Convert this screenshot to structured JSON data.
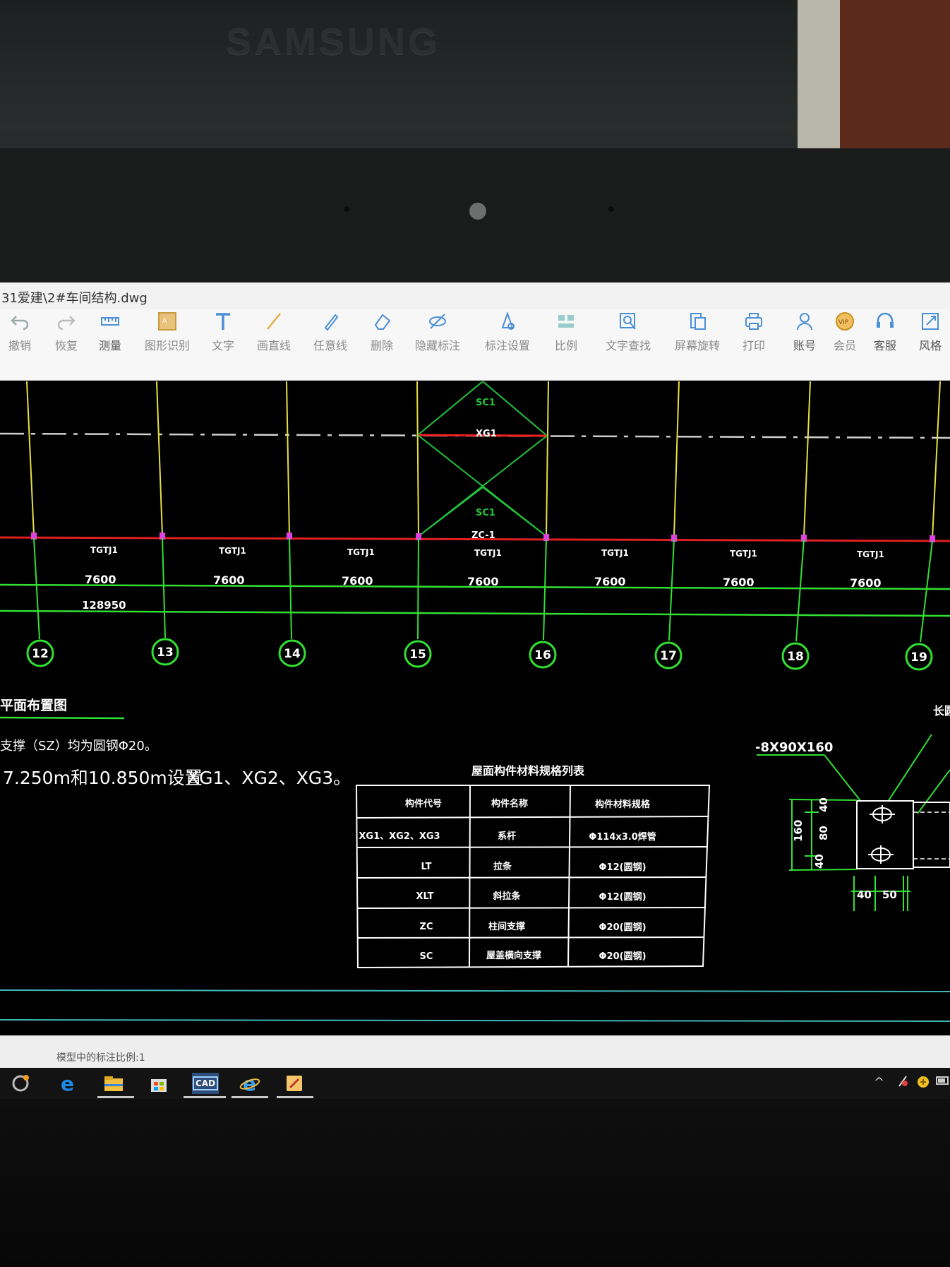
{
  "monitor": {
    "brand": "SAMSUNG"
  },
  "window": {
    "title": "31爱建\\2#车间结构.dwg"
  },
  "toolbar": {
    "items": [
      {
        "label": "撤销",
        "icon": "undo-icon"
      },
      {
        "label": "恢复",
        "icon": "redo-icon"
      },
      {
        "label": "测量",
        "icon": "measure-icon"
      },
      {
        "label": "图形识别",
        "icon": "shape-recognition-icon"
      },
      {
        "label": "文字",
        "icon": "text-icon"
      },
      {
        "label": "画直线",
        "icon": "line-icon"
      },
      {
        "label": "任意线",
        "icon": "freehand-icon"
      },
      {
        "label": "删除",
        "icon": "eraser-icon"
      },
      {
        "label": "隐藏标注",
        "icon": "hide-annotation-icon"
      },
      {
        "label": "标注设置",
        "icon": "annotation-settings-icon"
      },
      {
        "label": "比例",
        "icon": "scale-icon"
      },
      {
        "label": "文字查找",
        "icon": "text-search-icon"
      },
      {
        "label": "屏幕旋转",
        "icon": "rotate-screen-icon"
      },
      {
        "label": "打印",
        "icon": "print-icon"
      },
      {
        "label": "账号",
        "icon": "account-icon"
      },
      {
        "label": "会员",
        "icon": "vip-icon",
        "badge": "VIP"
      },
      {
        "label": "客服",
        "icon": "headset-icon"
      },
      {
        "label": "风格",
        "icon": "style-icon"
      }
    ]
  },
  "drawing": {
    "bracing": {
      "sc_top": "SC1",
      "xg": "XG1",
      "sc_bottom": "SC1",
      "zc": "ZC-1"
    },
    "beam_label": "TGTJ1",
    "bays": [
      "7600",
      "7600",
      "7600",
      "7600",
      "7600",
      "7600",
      "7600"
    ],
    "total_dim": "128950",
    "axes": [
      "12",
      "13",
      "14",
      "15",
      "16",
      "17",
      "18",
      "19"
    ],
    "plan_title": "平面布置图",
    "note1": "支撑（SZ）均为圆钢Φ20。",
    "note2_elev": "7.250m和10.850m设置",
    "note2_items": "XG1、XG2、XG3。",
    "table": {
      "title": "屋面构件材料规格列表",
      "headers": [
        "构件代号",
        "构件名称",
        "构件材料规格"
      ],
      "rows": [
        [
          "XG1、XG2、XG3",
          "系杆",
          "Φ114x3.0焊管"
        ],
        [
          "LT",
          "拉条",
          "Φ12(圆钢)"
        ],
        [
          "XLT",
          "斜拉条",
          "Φ12(圆钢)"
        ],
        [
          "ZC",
          "柱间支撑",
          "Φ20(圆钢)"
        ],
        [
          "SC",
          "屋盖横向支撑",
          "Φ20(圆钢)"
        ]
      ]
    },
    "detail": {
      "plate": "-8X90X160",
      "right_label": "长圆",
      "dim_total": "160",
      "dim_top": "40",
      "dim_mid": "80",
      "dim_bot": "40",
      "dim_h1": "40",
      "dim_h2": "50"
    }
  },
  "status": {
    "text": "模型中的标注比例:1"
  },
  "taskbar": {
    "apps": [
      "cortana-icon",
      "edge-icon",
      "file-explorer-icon",
      "store-icon",
      "cad-app-icon",
      "ie-icon",
      "notes-app-icon"
    ],
    "cad_label": "CAD"
  }
}
